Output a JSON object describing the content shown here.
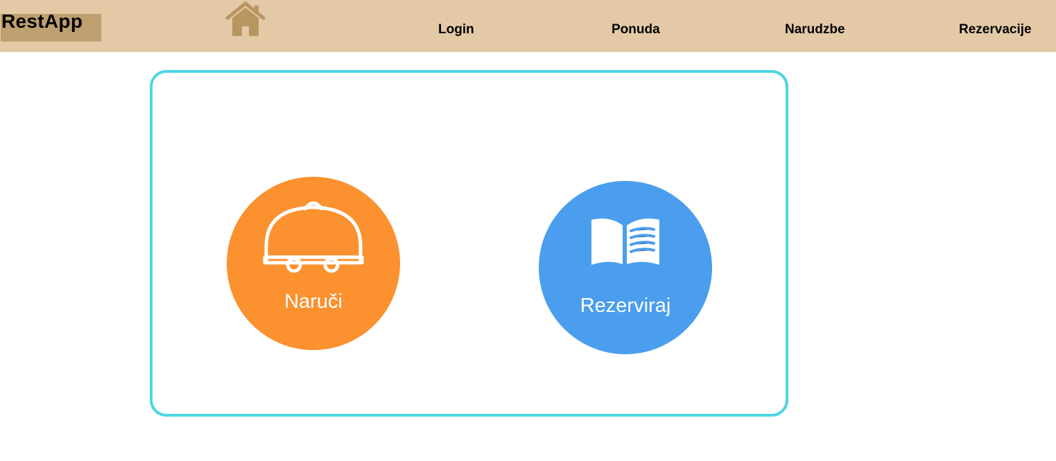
{
  "header": {
    "brand": "RestApp",
    "home_icon": "home-icon",
    "nav": {
      "login": "Login",
      "ponuda": "Ponuda",
      "narudzbe": "Narudzbe",
      "rezervacije": "Rezervacije"
    }
  },
  "main": {
    "order": {
      "label": "Naruči",
      "icon": "serving-cloche-icon",
      "color": "#fb912f"
    },
    "reserve": {
      "label": "Rezerviraj",
      "icon": "open-book-icon",
      "color": "#4a9eed"
    }
  },
  "colors": {
    "header_bg": "#e4c9a7",
    "brand_bg": "#bfa070",
    "home_icon": "#b89660",
    "panel_border": "#4dd6e3"
  }
}
